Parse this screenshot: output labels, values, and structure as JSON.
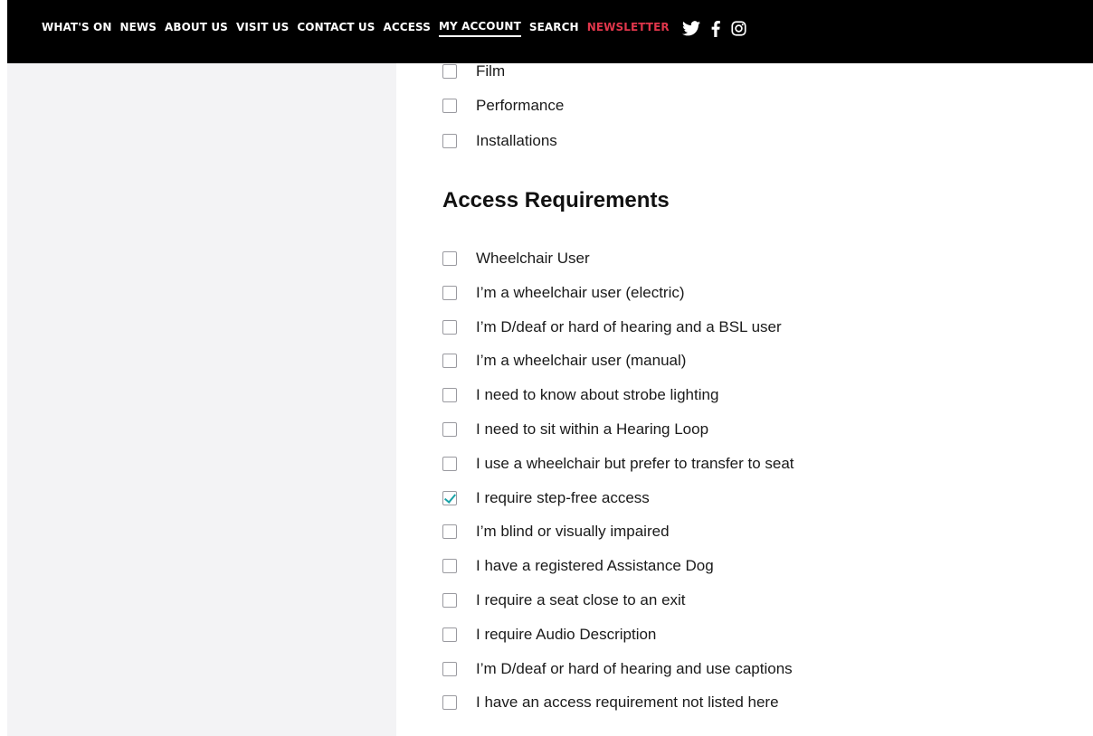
{
  "nav": {
    "items": [
      "WHAT'S ON",
      "NEWS",
      "ABOUT US",
      "VISIT US",
      "CONTACT US",
      "ACCESS",
      "MY ACCOUNT",
      "SEARCH",
      "NEWSLETTER"
    ],
    "active": "MY ACCOUNT",
    "newsletter_color": "#e0364b",
    "social_icons": [
      "twitter-icon",
      "facebook-icon",
      "instagram-icon"
    ]
  },
  "interests": [
    {
      "label": "Film",
      "checked": false
    },
    {
      "label": "Performance",
      "checked": false
    },
    {
      "label": "Installations",
      "checked": false
    }
  ],
  "access": {
    "heading": "Access Requirements",
    "options": [
      {
        "label": "Wheelchair User",
        "checked": false
      },
      {
        "label": "I’m a wheelchair user (electric)",
        "checked": false
      },
      {
        "label": "I’m D/deaf or hard of hearing and a BSL user",
        "checked": false
      },
      {
        "label": "I’m a wheelchair user (manual)",
        "checked": false
      },
      {
        "label": "I need to know about strobe lighting",
        "checked": false
      },
      {
        "label": "I need to sit within a Hearing Loop",
        "checked": false
      },
      {
        "label": "I use a wheelchair but prefer to transfer to seat",
        "checked": false
      },
      {
        "label": "I require step-free access",
        "checked": true
      },
      {
        "label": "I’m blind or visually impaired",
        "checked": false
      },
      {
        "label": "I have a registered Assistance Dog",
        "checked": false
      },
      {
        "label": "I require a seat close to an exit",
        "checked": false
      },
      {
        "label": "I require Audio Description",
        "checked": false
      },
      {
        "label": "I’m D/deaf or hard of hearing and use captions",
        "checked": false
      },
      {
        "label": "I have an access requirement not listed here",
        "checked": false
      }
    ]
  },
  "colors": {
    "check": "#1aa3a8",
    "topbar": "#000000",
    "left_panel": "#f3f3f5"
  }
}
